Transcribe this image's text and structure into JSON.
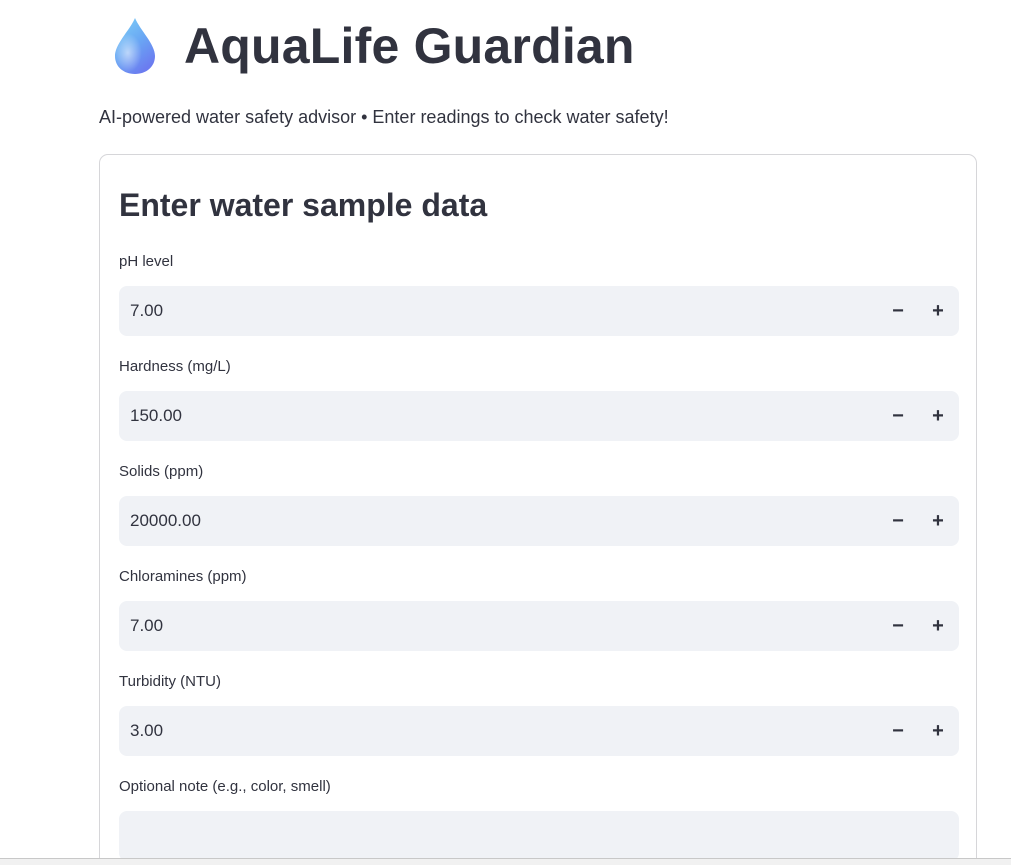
{
  "header": {
    "title": "AquaLife Guardian",
    "icon": "water-drop-icon",
    "subtitle": "AI-powered water safety advisor • Enter readings to check water safety!"
  },
  "form": {
    "title": "Enter water sample data",
    "fields": [
      {
        "label": "pH level",
        "value": "7.00"
      },
      {
        "label": "Hardness (mg/L)",
        "value": "150.00"
      },
      {
        "label": "Solids (ppm)",
        "value": "20000.00"
      },
      {
        "label": "Chloramines (ppm)",
        "value": "7.00"
      },
      {
        "label": "Turbidity (NTU)",
        "value": "3.00"
      }
    ],
    "note": {
      "label": "Optional note (e.g., color, smell)",
      "value": ""
    },
    "stepper": {
      "minus": "−",
      "plus": "+"
    }
  },
  "colors": {
    "text": "#31333f",
    "input_bg": "#f0f2f6",
    "card_border": "#d6d6d9",
    "drop_light": "#7fd3f7",
    "drop_dark": "#6b7cf0"
  }
}
